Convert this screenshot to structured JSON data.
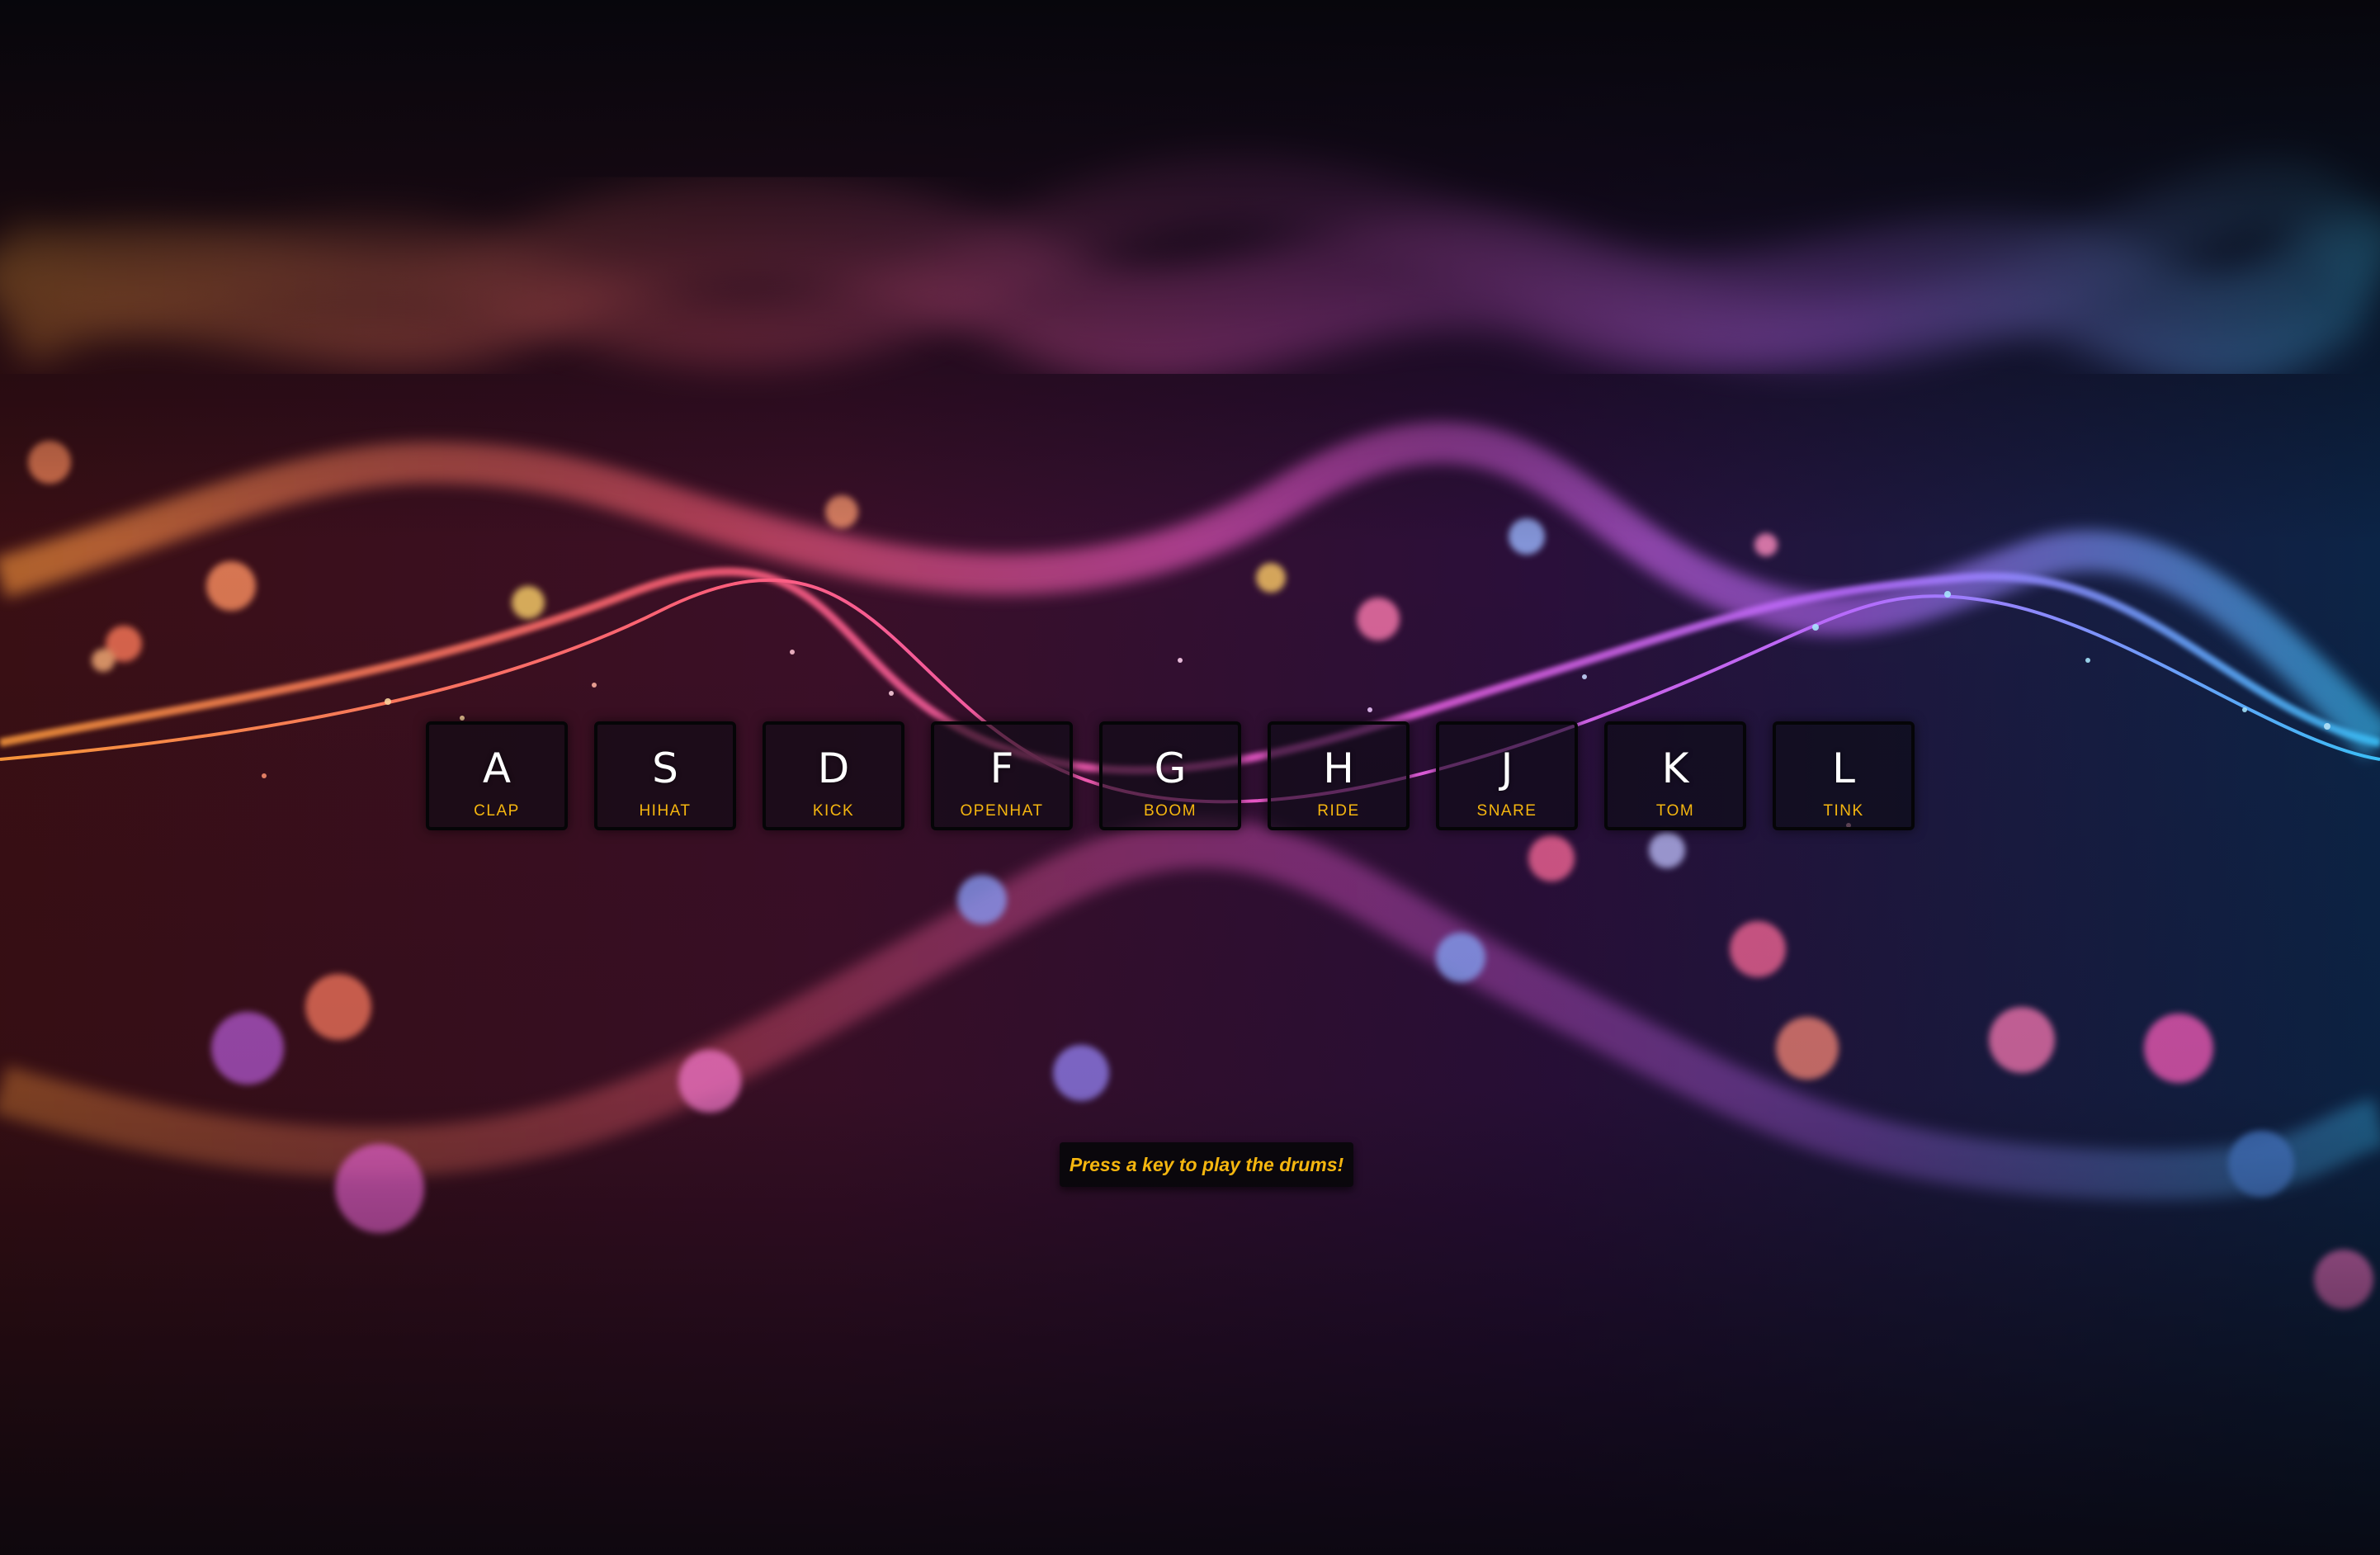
{
  "app": {
    "accent_color": "#f5b60f",
    "key_text_color": "#ffffff"
  },
  "drum_kit": {
    "keys": [
      {
        "letter": "A",
        "sound": "CLAP"
      },
      {
        "letter": "S",
        "sound": "HIHAT"
      },
      {
        "letter": "D",
        "sound": "KICK"
      },
      {
        "letter": "F",
        "sound": "OPENHAT"
      },
      {
        "letter": "G",
        "sound": "BOOM"
      },
      {
        "letter": "H",
        "sound": "RIDE"
      },
      {
        "letter": "J",
        "sound": "SNARE"
      },
      {
        "letter": "K",
        "sound": "TOM"
      },
      {
        "letter": "L",
        "sound": "TINK"
      }
    ]
  },
  "status": {
    "message": "Press a key to play the drums!"
  }
}
